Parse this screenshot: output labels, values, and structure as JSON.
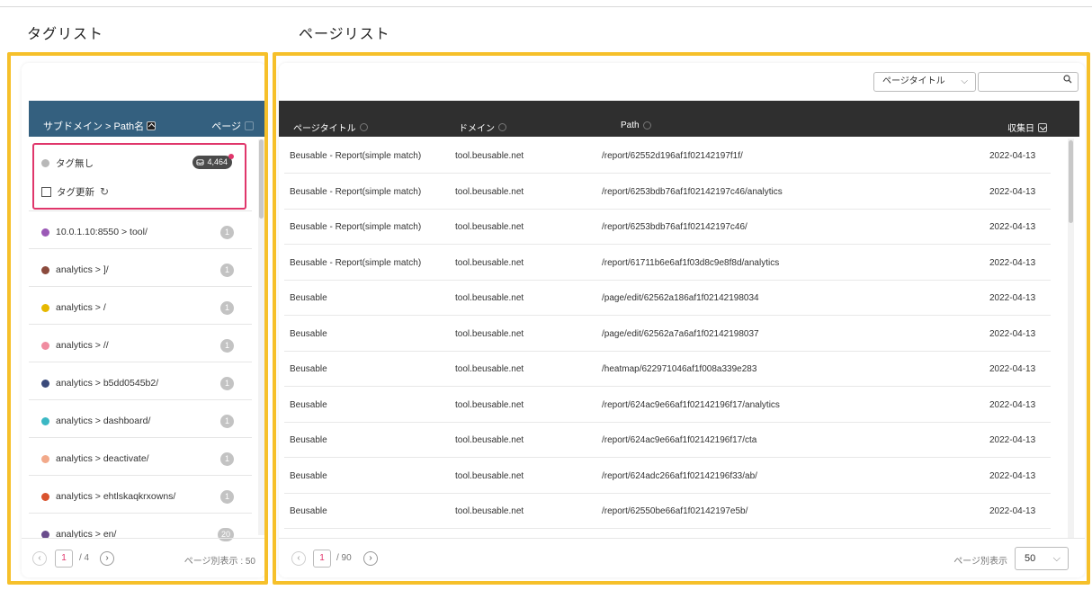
{
  "tag_section": {
    "title": "タグリスト",
    "header": {
      "col1": "サブドメイン > Path名",
      "col2": "ページ"
    },
    "untagged": {
      "label": "タグ無し",
      "count": "4,464",
      "color": "#b8b8b8"
    },
    "update": {
      "label": "タグ更新"
    },
    "items": [
      {
        "label": "10.0.1.10:8550 > tool/",
        "count": "1",
        "color": "#9b59b6"
      },
      {
        "label": "analytics > ]/",
        "count": "1",
        "color": "#8b4a3c"
      },
      {
        "label": "analytics > /",
        "count": "1",
        "color": "#e6b800"
      },
      {
        "label": "analytics > //",
        "count": "1",
        "color": "#f08ca0"
      },
      {
        "label": "analytics > b5dd0545b2/",
        "count": "1",
        "color": "#3a4a7a"
      },
      {
        "label": "analytics > dashboard/",
        "count": "1",
        "color": "#3bb8c4"
      },
      {
        "label": "analytics > deactivate/",
        "count": "1",
        "color": "#f2a98a"
      },
      {
        "label": "analytics > ehtlskaqkrxowns/",
        "count": "1",
        "color": "#d9532e"
      },
      {
        "label": "analytics > en/",
        "count": "20",
        "color": "#6a4c8c"
      }
    ],
    "pager": {
      "current": "1",
      "total": "/ 4",
      "per_page": "ページ別表示 : 50",
      "prev": "‹",
      "next": "›"
    }
  },
  "page_section": {
    "title": "ページリスト",
    "filter": {
      "selected": "ページタイトル",
      "search_placeholder": ""
    },
    "columns": {
      "title": "ページタイトル",
      "domain": "ドメイン",
      "path": "Path",
      "date": "収集日"
    },
    "rows": [
      {
        "title": "Beusable - Report(simple match)",
        "domain": "tool.beusable.net",
        "path": "/report/62552d196af1f02142197f1f/",
        "date": "2022-04-13"
      },
      {
        "title": "Beusable - Report(simple match)",
        "domain": "tool.beusable.net",
        "path": "/report/6253bdb76af1f02142197c46/analytics",
        "date": "2022-04-13"
      },
      {
        "title": "Beusable - Report(simple match)",
        "domain": "tool.beusable.net",
        "path": "/report/6253bdb76af1f02142197c46/",
        "date": "2022-04-13"
      },
      {
        "title": "Beusable - Report(simple match)",
        "domain": "tool.beusable.net",
        "path": "/report/61711b6e6af1f03d8c9e8f8d/analytics",
        "date": "2022-04-13"
      },
      {
        "title": "Beusable",
        "domain": "tool.beusable.net",
        "path": "/page/edit/62562a186af1f02142198034",
        "date": "2022-04-13"
      },
      {
        "title": "Beusable",
        "domain": "tool.beusable.net",
        "path": "/page/edit/62562a7a6af1f02142198037",
        "date": "2022-04-13"
      },
      {
        "title": "Beusable",
        "domain": "tool.beusable.net",
        "path": "/heatmap/622971046af1f008a339e283",
        "date": "2022-04-13"
      },
      {
        "title": "Beusable",
        "domain": "tool.beusable.net",
        "path": "/report/624ac9e66af1f02142196f17/analytics",
        "date": "2022-04-13"
      },
      {
        "title": "Beusable",
        "domain": "tool.beusable.net",
        "path": "/report/624ac9e66af1f02142196f17/cta",
        "date": "2022-04-13"
      },
      {
        "title": "Beusable",
        "domain": "tool.beusable.net",
        "path": "/report/624adc266af1f02142196f33/ab/",
        "date": "2022-04-13"
      },
      {
        "title": "Beusable",
        "domain": "tool.beusable.net",
        "path": "/report/62550be66af1f02142197e5b/",
        "date": "2022-04-13"
      }
    ],
    "pager": {
      "current": "1",
      "total": "/ 90",
      "per_page_label": "ページ別表示",
      "per_page_value": "50",
      "prev": "‹",
      "next": "›"
    }
  },
  "colors": {
    "highlight": "#f6c02a",
    "tag_header": "#34607f",
    "table_header": "#2f2f2f",
    "accent": "#e0366b"
  }
}
